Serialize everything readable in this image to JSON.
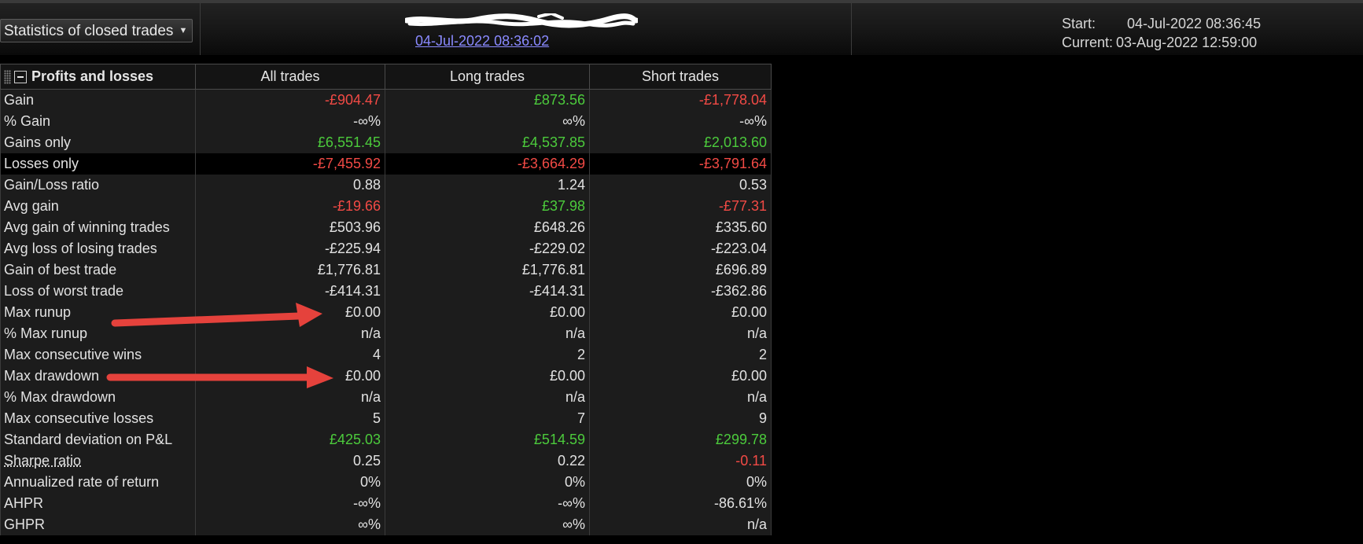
{
  "header": {
    "mode_select": "Statistics of closed trades",
    "account_name": "",
    "account_date": "04-Jul-2022 08:36:02",
    "start_label": "Start:",
    "start_value": "04-Jul-2022 08:36:45",
    "current_label": "Current:",
    "current_value": "03-Aug-2022 12:59:00"
  },
  "table": {
    "section_title": "Profits and losses",
    "columns": [
      "All trades",
      "Long trades",
      "Short trades"
    ],
    "rows": [
      {
        "label": "Gain",
        "values": [
          "-£904.47",
          "£873.56",
          "-£1,778.04"
        ],
        "colors": [
          "neg",
          "pos",
          "neg"
        ]
      },
      {
        "label": "% Gain",
        "values": [
          "-∞%",
          "∞%",
          "-∞%"
        ],
        "colors": [
          "",
          "",
          ""
        ]
      },
      {
        "label": "Gains only",
        "values": [
          "£6,551.45",
          "£4,537.85",
          "£2,013.60"
        ],
        "colors": [
          "pos",
          "pos",
          "pos"
        ]
      },
      {
        "label": "Losses only",
        "values": [
          "-£7,455.92",
          "-£3,664.29",
          "-£3,791.64"
        ],
        "colors": [
          "neg",
          "neg",
          "neg"
        ]
      },
      {
        "label": "Gain/Loss ratio",
        "values": [
          "0.88",
          "1.24",
          "0.53"
        ],
        "colors": [
          "",
          "",
          ""
        ]
      },
      {
        "label": "Avg gain",
        "values": [
          "-£19.66",
          "£37.98",
          "-£77.31"
        ],
        "colors": [
          "neg",
          "pos",
          "neg"
        ]
      },
      {
        "label": "Avg gain of winning trades",
        "values": [
          "£503.96",
          "£648.26",
          "£335.60"
        ],
        "colors": [
          "",
          "",
          ""
        ]
      },
      {
        "label": "Avg loss of losing trades",
        "values": [
          "-£225.94",
          "-£229.02",
          "-£223.04"
        ],
        "colors": [
          "",
          "",
          ""
        ]
      },
      {
        "label": "Gain of best trade",
        "values": [
          "£1,776.81",
          "£1,776.81",
          "£696.89"
        ],
        "colors": [
          "",
          "",
          ""
        ]
      },
      {
        "label": "Loss of worst trade",
        "values": [
          "-£414.31",
          "-£414.31",
          "-£362.86"
        ],
        "colors": [
          "",
          "",
          ""
        ]
      },
      {
        "label": "Max runup",
        "values": [
          "£0.00",
          "£0.00",
          "£0.00"
        ],
        "colors": [
          "",
          "",
          ""
        ]
      },
      {
        "label": "% Max runup",
        "values": [
          "n/a",
          "n/a",
          "n/a"
        ],
        "colors": [
          "",
          "",
          ""
        ]
      },
      {
        "label": "Max consecutive wins",
        "values": [
          "4",
          "2",
          "2"
        ],
        "colors": [
          "",
          "",
          ""
        ]
      },
      {
        "label": "Max drawdown",
        "values": [
          "£0.00",
          "£0.00",
          "£0.00"
        ],
        "colors": [
          "",
          "",
          ""
        ]
      },
      {
        "label": "% Max drawdown",
        "values": [
          "n/a",
          "n/a",
          "n/a"
        ],
        "colors": [
          "",
          "",
          ""
        ]
      },
      {
        "label": "Max consecutive losses",
        "values": [
          "5",
          "7",
          "9"
        ],
        "colors": [
          "",
          "",
          ""
        ]
      },
      {
        "label": "Standard deviation on P&L",
        "values": [
          "£425.03",
          "£514.59",
          "£299.78"
        ],
        "colors": [
          "pos",
          "pos",
          "pos"
        ]
      },
      {
        "label": "Sharpe ratio",
        "values": [
          "0.25",
          "0.22",
          "-0.11"
        ],
        "colors": [
          "",
          "",
          "neg"
        ]
      },
      {
        "label": "Annualized rate of return",
        "values": [
          "0%",
          "0%",
          "0%"
        ],
        "colors": [
          "",
          "",
          ""
        ]
      },
      {
        "label": "AHPR",
        "values": [
          "-∞%",
          "-∞%",
          "-86.61%"
        ],
        "colors": [
          "",
          "",
          ""
        ]
      },
      {
        "label": "GHPR",
        "values": [
          "∞%",
          "∞%",
          "n/a"
        ],
        "colors": [
          "",
          "",
          ""
        ]
      }
    ]
  },
  "colors": {
    "positive": "#4ccb3c",
    "negative": "#f24a45",
    "link": "#8a8aff",
    "annotation_arrow": "#e5423c"
  },
  "icons": {
    "dropdown": "chevron-down-icon",
    "collapse": "minus-box-icon",
    "grip": "drag-handle-icon"
  }
}
